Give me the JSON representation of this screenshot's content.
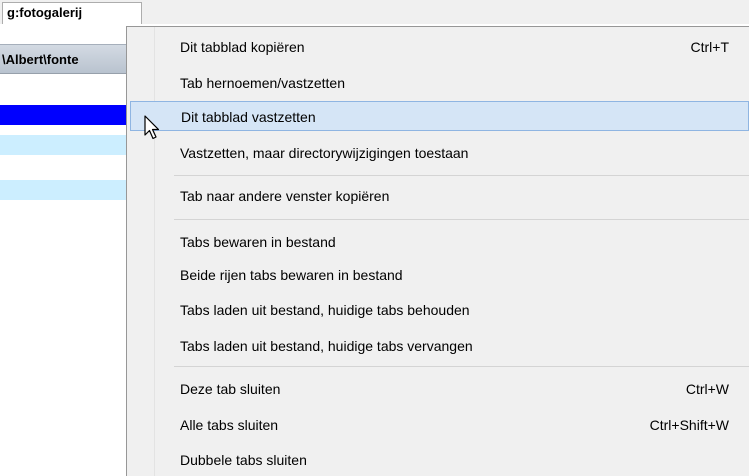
{
  "tab": {
    "title": "g:fotogalerij"
  },
  "panel": {
    "path": "\\Albert\\fonte"
  },
  "file_rows": [
    {
      "color": "#0000ff"
    },
    {
      "color": "#cceeff"
    },
    {
      "color": "#cceeff"
    }
  ],
  "menu": {
    "items": [
      {
        "label": "Dit tabblad kopiëren",
        "shortcut": "Ctrl+T"
      },
      {
        "label": "Tab hernoemen/vastzetten",
        "shortcut": ""
      },
      {
        "label": "Dit tabblad vastzetten",
        "shortcut": ""
      },
      {
        "label": "Vastzetten, maar directorywijzigingen toestaan",
        "shortcut": ""
      },
      {
        "label": "Tab naar andere venster kopiëren",
        "shortcut": ""
      },
      {
        "label": "Tabs bewaren in bestand",
        "shortcut": ""
      },
      {
        "label": "Beide rijen tabs bewaren in bestand",
        "shortcut": ""
      },
      {
        "label": "Tabs laden uit bestand, huidige tabs behouden",
        "shortcut": ""
      },
      {
        "label": "Tabs laden uit bestand, huidige tabs vervangen",
        "shortcut": ""
      },
      {
        "label": "Deze tab sluiten",
        "shortcut": "Ctrl+W"
      },
      {
        "label": "Alle tabs sluiten",
        "shortcut": "Ctrl+Shift+W"
      },
      {
        "label": "Dubbele tabs sluiten",
        "shortcut": ""
      }
    ],
    "highlighted_item": "Dit tabblad vastzetten",
    "highlight_color": "#d5e5f6"
  }
}
